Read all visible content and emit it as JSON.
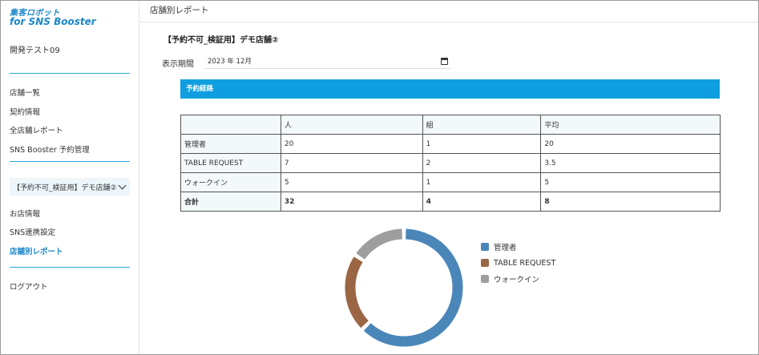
{
  "sidebar": {
    "logo_line1": "集客ロボット",
    "logo_line2": "for SNS Booster",
    "account": "開発テスト09",
    "nav_top": [
      "店舗一覧",
      "契約情報",
      "全店舗レポート",
      "SNS Booster 予約管理"
    ],
    "store_select": "【予約不可_検証用】デモ店舗②",
    "nav_store": [
      "お店情報",
      "SNS連携設定",
      "店舗別レポート"
    ],
    "logout": "ログアウト"
  },
  "topbar": {
    "title": "店舗別レポート"
  },
  "main": {
    "store_title": "【予約不可_検証用】デモ店舗②",
    "period_label": "表示期間",
    "period_value": "2023 年 12月",
    "section_title": "予約経路",
    "table": {
      "headers": [
        "",
        "人",
        "組",
        "平均"
      ],
      "rows": [
        [
          "管理者",
          "20",
          "1",
          "20"
        ],
        [
          "TABLE REQUEST",
          "7",
          "2",
          "3.5"
        ],
        [
          "ウォークイン",
          "5",
          "1",
          "5"
        ]
      ],
      "total": [
        "合計",
        "32",
        "4",
        "8"
      ]
    }
  },
  "chart_data": {
    "type": "pie",
    "categories": [
      "管理者",
      "TABLE REQUEST",
      "ウォークイン"
    ],
    "values": [
      20,
      7,
      5
    ],
    "colors": [
      "#4a86b8",
      "#9a6644",
      "#9e9e9e"
    ]
  }
}
